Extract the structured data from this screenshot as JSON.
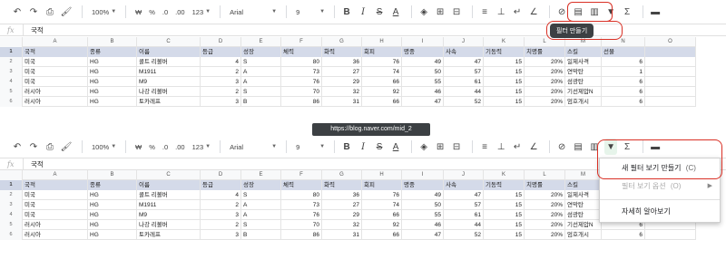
{
  "toolbar": {
    "zoom": "100%",
    "currency": "₩",
    "percent": "%",
    "dec_less": ".0",
    "dec_more": ".00",
    "format_123": "123",
    "font": "Arial",
    "font_size": "9",
    "bold": "B",
    "italic": "I",
    "strike": "S",
    "text_color": "A",
    "sigma": "Σ"
  },
  "formula_bar": {
    "fx": "fx",
    "value": "국적"
  },
  "columns": [
    "A",
    "B",
    "C",
    "D",
    "E",
    "F",
    "G",
    "H",
    "I",
    "J",
    "K",
    "L",
    "M",
    "N",
    "O"
  ],
  "header_row": {
    "num": "1",
    "cells": [
      "국적",
      "종류",
      "이름",
      "등급",
      "성장",
      "체력",
      "화력",
      "회피",
      "명중",
      "사속",
      "기동력",
      "치명률",
      "스킬",
      "선물",
      ""
    ]
  },
  "rows": [
    {
      "num": "2",
      "cells": [
        "미국",
        "HG",
        "콜트 리볼버",
        "4",
        "S",
        "80",
        "36",
        "76",
        "49",
        "47",
        "15",
        "20%",
        "일제사격",
        "6",
        ""
      ]
    },
    {
      "num": "3",
      "cells": [
        "미국",
        "HG",
        "M1911",
        "2",
        "A",
        "73",
        "27",
        "74",
        "50",
        "57",
        "15",
        "20%",
        "연막탄",
        "1",
        ""
      ]
    },
    {
      "num": "4",
      "cells": [
        "미국",
        "HG",
        "M9",
        "3",
        "A",
        "76",
        "29",
        "66",
        "55",
        "61",
        "15",
        "20%",
        "섬광탄",
        "6",
        ""
      ]
    },
    {
      "num": "5",
      "cells": [
        "러시아",
        "HG",
        "나강 리볼버",
        "2",
        "S",
        "70",
        "32",
        "92",
        "46",
        "44",
        "15",
        "20%",
        "기선제압N",
        "6",
        ""
      ]
    },
    {
      "num": "6",
      "cells": [
        "러시아",
        "HG",
        "토카레프",
        "3",
        "B",
        "86",
        "31",
        "66",
        "47",
        "52",
        "15",
        "20%",
        "엄호개시",
        "6",
        ""
      ]
    }
  ],
  "tooltip": "필터 만들기",
  "watermark": "https://blog.naver.com/mid_2",
  "menu": {
    "item1": "새 필터 보기 만들기",
    "item1_shortcut": "(C)",
    "item2": "필터 보기 옵션",
    "item2_shortcut": "(O)",
    "item3": "자세히 알아보기"
  },
  "colors": {
    "highlight": "#d93025",
    "header_fill": "#d4dae9"
  }
}
